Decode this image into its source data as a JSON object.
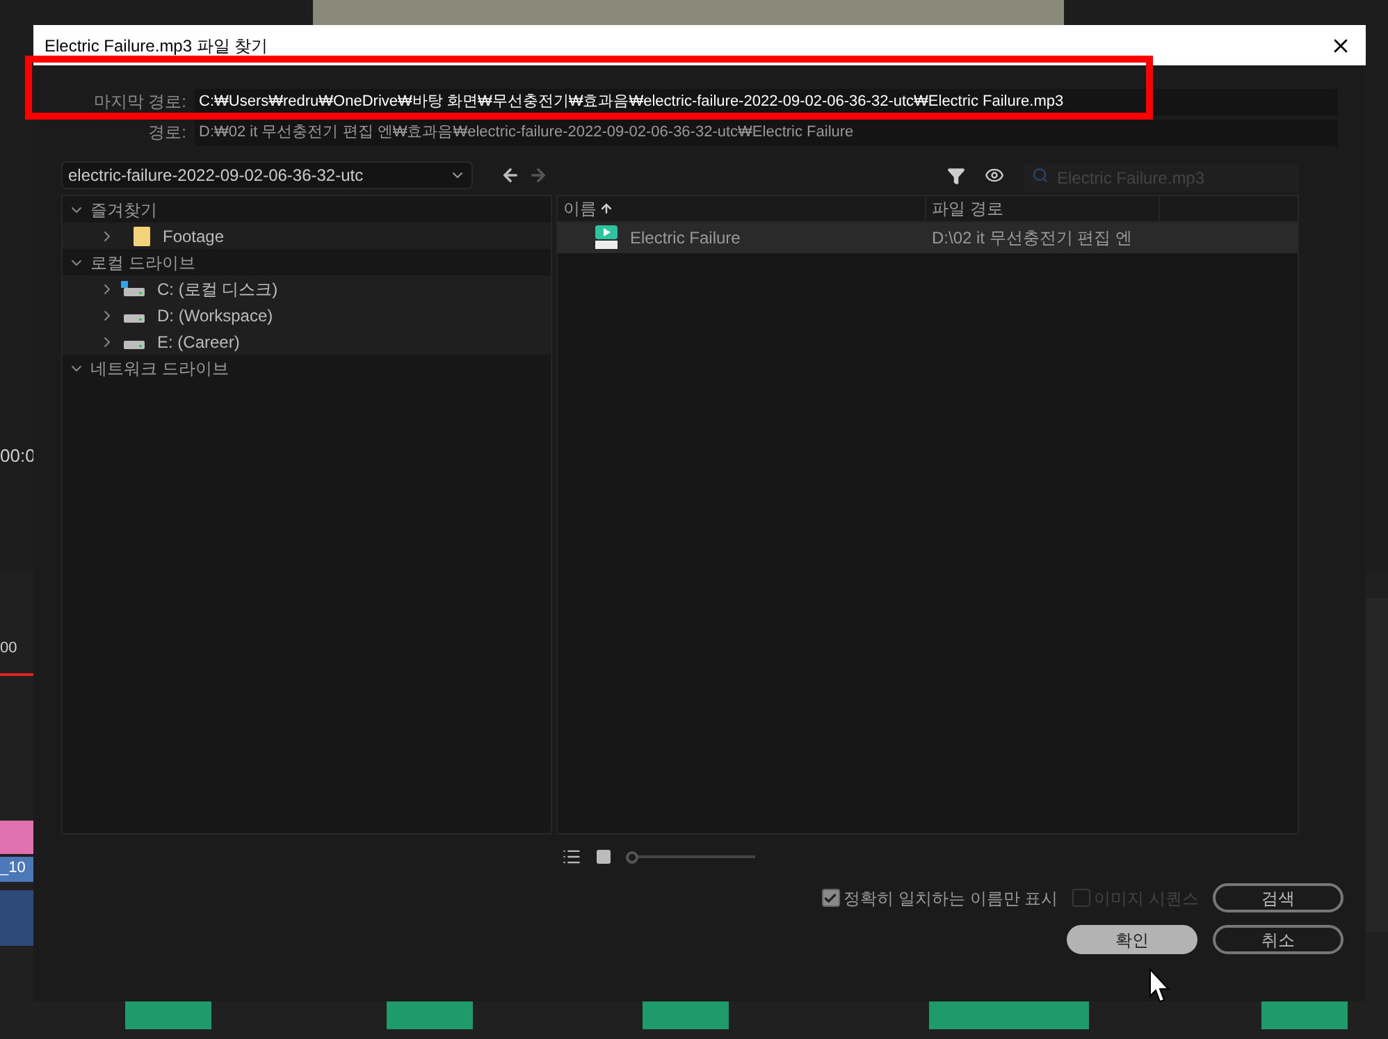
{
  "background": {
    "texts": [
      "00:0",
      "00",
      "_10"
    ]
  },
  "dialog": {
    "title": "Electric Failure.mp3 파일 찾기",
    "last_path": {
      "label": "마지막 경로:",
      "value": "C:₩Users₩redru₩OneDrive₩바탕 화면₩무선충전기₩효과음₩electric-failure-2022-09-02-06-36-32-utc₩Electric Failure.mp3"
    },
    "path": {
      "label": "경로:",
      "value": "D:₩02 it 무선충전기 편집 엔₩효과음₩electric-failure-2022-09-02-06-36-32-utc₩Electric Failure"
    },
    "folder_dropdown": {
      "value": "electric-failure-2022-09-02-06-36-32-utc"
    },
    "nav_buttons": [
      {
        "kind": "back",
        "disabled": false
      },
      {
        "kind": "forward",
        "disabled": true
      }
    ],
    "tree": [
      {
        "label": "즐겨찾기",
        "expanded": true,
        "children": [
          {
            "label": "Footage",
            "kind": "folder",
            "expanded": false
          }
        ]
      },
      {
        "label": "로컬 드라이브",
        "expanded": true,
        "children": [
          {
            "label": "C: (로컬 디스크)",
            "kind": "system-drive",
            "expanded": false
          },
          {
            "label": "D: (Workspace)",
            "kind": "drive",
            "expanded": false
          },
          {
            "label": "E: (Career)",
            "kind": "drive",
            "expanded": false
          }
        ]
      },
      {
        "label": "네트워크 드라이브",
        "expanded": true
      }
    ],
    "zoom_slider": {
      "level": 0
    },
    "search": {
      "placeholder": "Electric Failure.mp3"
    },
    "columns": [
      "이름",
      "파일 경로"
    ],
    "rows": [
      {
        "name": "Electric Failure",
        "path": "D:\\02 it 무선충전기 편집 엔",
        "selected": true
      }
    ],
    "options": [
      {
        "label": "정확히 일치하는 이름만 표시",
        "checked": true,
        "disabled": false
      },
      {
        "label": "이미지 시퀀스",
        "checked": false,
        "disabled": true
      }
    ],
    "buttons": [
      {
        "label": "검색",
        "kind": "secondary"
      },
      {
        "label": "확인",
        "kind": "primary"
      },
      {
        "label": "취소",
        "kind": "secondary"
      }
    ]
  }
}
